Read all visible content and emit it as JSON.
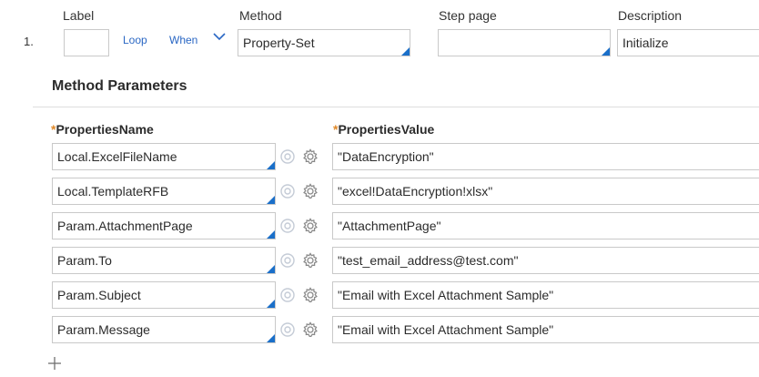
{
  "step": {
    "number": "1.",
    "headers": {
      "label": "Label",
      "method": "Method",
      "step_page": "Step page",
      "description": "Description"
    },
    "label_value": "",
    "loop_link": "Loop",
    "when_link": "When",
    "method_value": "Property-Set",
    "step_page_value": "",
    "description_value": "Initialize"
  },
  "method_parameters": {
    "title": "Method Parameters",
    "name_header": "PropertiesName",
    "value_header": "PropertiesValue",
    "required_marker": "*",
    "rows": [
      {
        "name": "Local.ExcelFileName",
        "value": "\"DataEncryption\""
      },
      {
        "name": "Local.TemplateRFB",
        "value": "\"excel!DataEncryption!xlsx\""
      },
      {
        "name": "Param.AttachmentPage",
        "value": "\"AttachmentPage\""
      },
      {
        "name": "Param.To",
        "value": "\"test_email_address@test.com\""
      },
      {
        "name": "Param.Subject",
        "value": "\"Email with Excel Attachment Sample\""
      },
      {
        "name": "Param.Message",
        "value": "\"Email with Excel Attachment Sample\""
      }
    ]
  },
  "colors": {
    "accent": "#1a6fc9",
    "link": "#2a67c4",
    "required": "#e08a2a",
    "border": "#c9c9c9",
    "icon": "#8a8a8a",
    "icon_light": "#c4cbd6"
  },
  "icons": [
    "chevron-down-icon",
    "target-icon",
    "gear-icon",
    "plus-icon"
  ]
}
